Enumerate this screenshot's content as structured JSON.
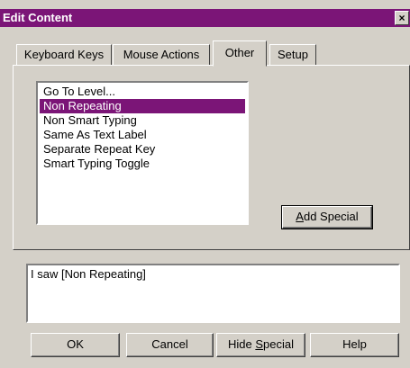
{
  "window": {
    "title": "Edit Content",
    "close_glyph": "×",
    "tabs": [
      {
        "label": "Keyboard Keys",
        "active": false
      },
      {
        "label": "Mouse Actions",
        "active": false
      },
      {
        "label": "Other",
        "active": true
      },
      {
        "label": "Setup",
        "active": false
      }
    ],
    "list": {
      "items": [
        "Go To Level...",
        "Non Repeating",
        "Non Smart Typing",
        "Same As Text Label",
        "Separate Repeat Key",
        "Smart Typing Toggle"
      ],
      "selected_index": 1
    },
    "add_special": {
      "mnemonic": "A",
      "rest": "dd Special"
    },
    "text_content": "I saw [Non Repeating]",
    "buttons": {
      "ok": "OK",
      "cancel": "Cancel",
      "hide_special": {
        "before": "Hide ",
        "mnemonic": "S",
        "after": "pecial"
      },
      "help": "Help"
    },
    "colors": {
      "titlebar": "#7b1577",
      "selection": "#7b1577",
      "face": "#d4d0c8"
    }
  }
}
